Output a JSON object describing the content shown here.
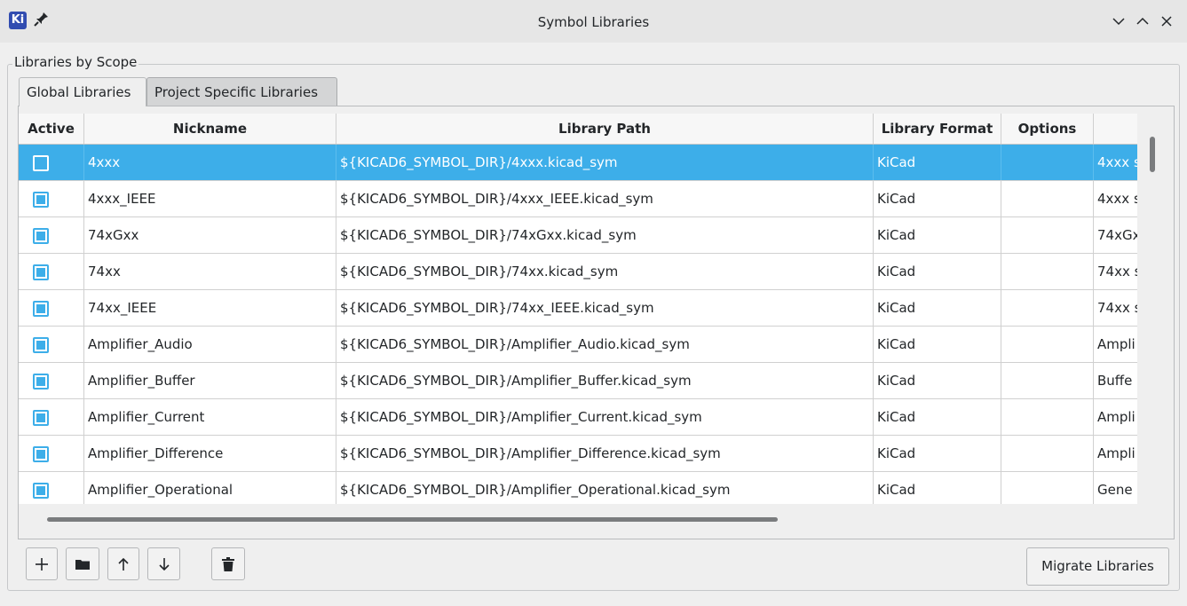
{
  "window": {
    "title": "Symbol Libraries",
    "app_icon_text": "Ki"
  },
  "group": {
    "label": "Libraries by Scope"
  },
  "tabs": [
    {
      "label": "Global Libraries",
      "active": true
    },
    {
      "label": "Project Specific Libraries",
      "active": false
    }
  ],
  "table": {
    "headers": [
      "Active",
      "Nickname",
      "Library Path",
      "Library Format",
      "Options",
      ""
    ],
    "rows": [
      {
        "active": false,
        "nickname": "4xxx",
        "path": "${KICAD6_SYMBOL_DIR}/4xxx.kicad_sym",
        "format": "KiCad",
        "options": "",
        "desc": "4xxx s",
        "selected": true
      },
      {
        "active": true,
        "nickname": "4xxx_IEEE",
        "path": "${KICAD6_SYMBOL_DIR}/4xxx_IEEE.kicad_sym",
        "format": "KiCad",
        "options": "",
        "desc": "4xxx s"
      },
      {
        "active": true,
        "nickname": "74xGxx",
        "path": "${KICAD6_SYMBOL_DIR}/74xGxx.kicad_sym",
        "format": "KiCad",
        "options": "",
        "desc": "74xGx"
      },
      {
        "active": true,
        "nickname": "74xx",
        "path": "${KICAD6_SYMBOL_DIR}/74xx.kicad_sym",
        "format": "KiCad",
        "options": "",
        "desc": "74xx s"
      },
      {
        "active": true,
        "nickname": "74xx_IEEE",
        "path": "${KICAD6_SYMBOL_DIR}/74xx_IEEE.kicad_sym",
        "format": "KiCad",
        "options": "",
        "desc": "74xx s"
      },
      {
        "active": true,
        "nickname": "Amplifier_Audio",
        "path": "${KICAD6_SYMBOL_DIR}/Amplifier_Audio.kicad_sym",
        "format": "KiCad",
        "options": "",
        "desc": "Ampli"
      },
      {
        "active": true,
        "nickname": "Amplifier_Buffer",
        "path": "${KICAD6_SYMBOL_DIR}/Amplifier_Buffer.kicad_sym",
        "format": "KiCad",
        "options": "",
        "desc": "Buffe"
      },
      {
        "active": true,
        "nickname": "Amplifier_Current",
        "path": "${KICAD6_SYMBOL_DIR}/Amplifier_Current.kicad_sym",
        "format": "KiCad",
        "options": "",
        "desc": "Ampli"
      },
      {
        "active": true,
        "nickname": "Amplifier_Difference",
        "path": "${KICAD6_SYMBOL_DIR}/Amplifier_Difference.kicad_sym",
        "format": "KiCad",
        "options": "",
        "desc": "Ampli"
      },
      {
        "active": true,
        "nickname": "Amplifier_Operational",
        "path": "${KICAD6_SYMBOL_DIR}/Amplifier_Operational.kicad_sym",
        "format": "KiCad",
        "options": "",
        "desc": "Gene"
      }
    ]
  },
  "toolbar": {
    "buttons": [
      {
        "icon": "plus-icon"
      },
      {
        "icon": "folder-icon"
      },
      {
        "icon": "arrow-up-icon"
      },
      {
        "icon": "arrow-down-icon"
      },
      {
        "icon": "trash-icon"
      }
    ],
    "migrate_label": "Migrate Libraries"
  },
  "colors": {
    "accent": "#3daee9",
    "window_bg": "#efefef",
    "titlebar_bg": "#e6e6e6",
    "app_icon_bg": "#314cb0"
  }
}
